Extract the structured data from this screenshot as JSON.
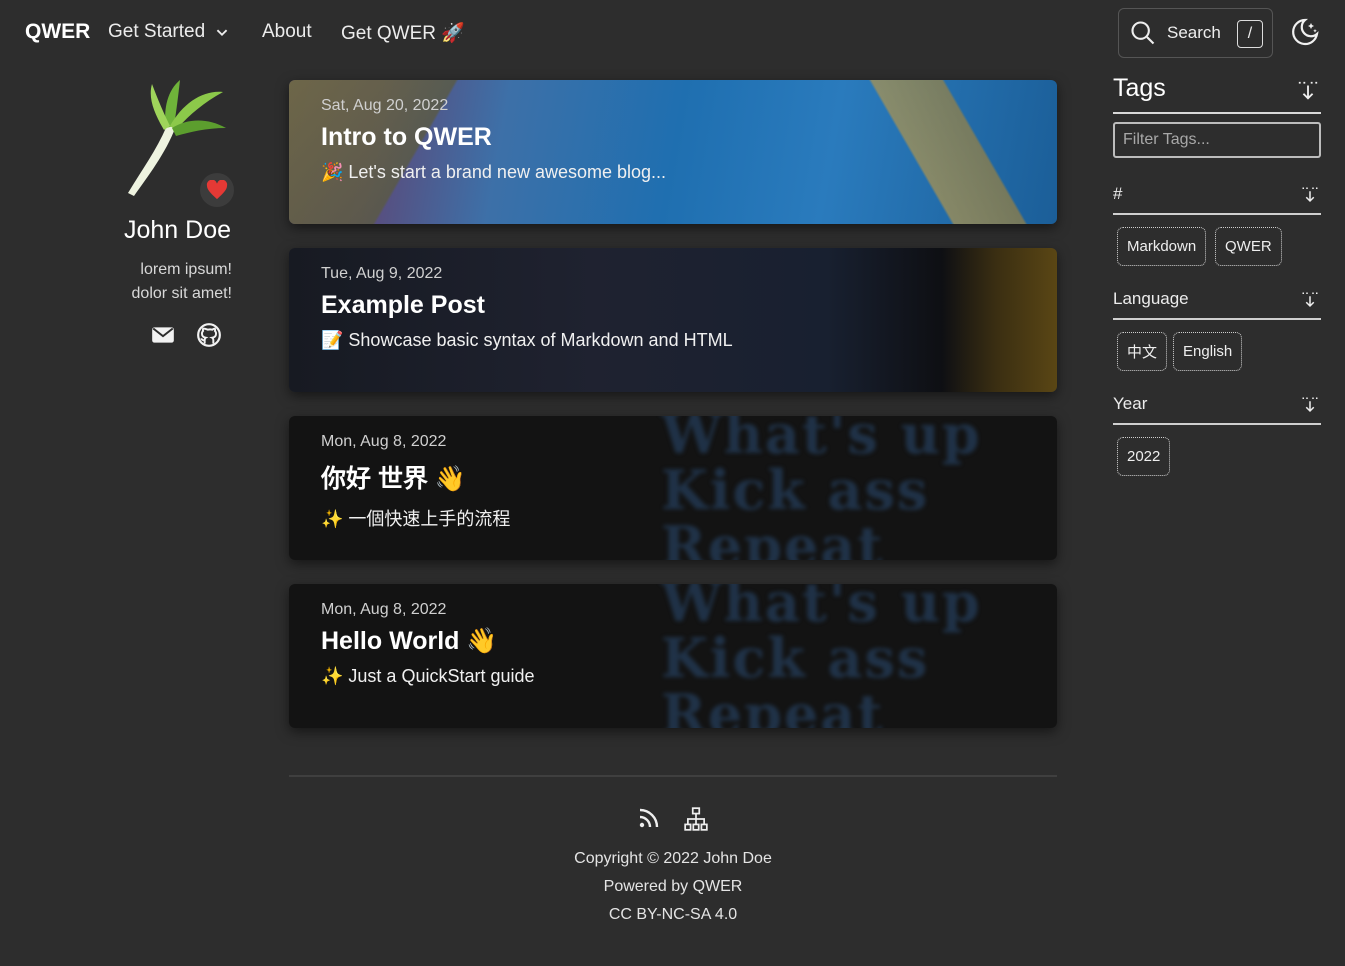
{
  "nav": {
    "brand": "QWER",
    "links": [
      "Get Started",
      "About",
      "Get QWER 🚀"
    ],
    "search_label": "Search",
    "search_shortcut": "/"
  },
  "profile": {
    "name": "John Doe",
    "bio_line1": "lorem ipsum!",
    "bio_line2": "dolor sit amet!"
  },
  "posts": [
    {
      "date": "Sat, Aug 20, 2022",
      "title": "Intro to QWER",
      "summary": "🎉 Let's start a brand new awesome blog..."
    },
    {
      "date": "Tue, Aug 9, 2022",
      "title": "Example Post",
      "summary": "📝 Showcase basic syntax of Markdown and HTML"
    },
    {
      "date": "Mon, Aug 8, 2022",
      "title": "你好 世界 👋",
      "summary": "✨ 一個快速上手的流程"
    },
    {
      "date": "Mon, Aug 8, 2022",
      "title": "Hello World 👋",
      "summary": "✨ Just a QuickStart guide"
    }
  ],
  "post_bg_text": [
    "What's up",
    "Kick ass",
    "Repeat"
  ],
  "footer": {
    "copyright": "Copyright © 2022 John Doe",
    "powered": "Powered by QWER",
    "license": "CC BY-NC-SA 4.0"
  },
  "tags": {
    "title": "Tags",
    "filter_placeholder": "Filter Tags...",
    "groups": [
      {
        "title": "#",
        "items": [
          "Markdown",
          "QWER"
        ]
      },
      {
        "title": "Language",
        "items": [
          "中文",
          "English"
        ]
      },
      {
        "title": "Year",
        "items": [
          "2022"
        ]
      }
    ]
  },
  "colors": {
    "background": "#2d2d2d",
    "heart": "#e53935"
  },
  "icons": [
    "chevron-down-icon",
    "search-icon",
    "theme-toggle-icon",
    "heart-icon",
    "mail-icon",
    "github-icon",
    "rss-icon",
    "sitemap-icon",
    "sort-icon"
  ]
}
